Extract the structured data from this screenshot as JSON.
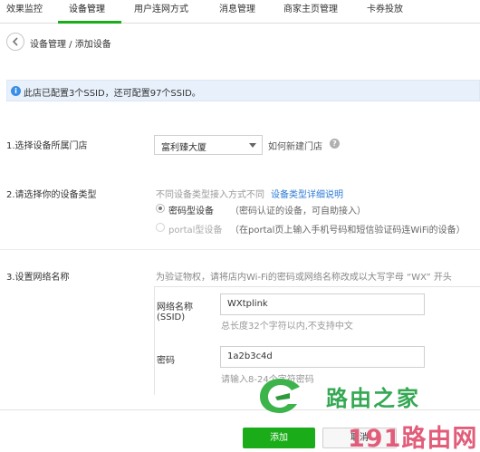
{
  "tabs": [
    {
      "label": "效果监控"
    },
    {
      "label": "设备管理"
    },
    {
      "label": "用户连网方式"
    },
    {
      "label": "消息管理"
    },
    {
      "label": "商家主页管理"
    },
    {
      "label": "卡券投放"
    }
  ],
  "breadcrumb": {
    "text": "设备管理 / 添加设备"
  },
  "notice": {
    "text": "此店已配置3个SSID，还可配置97个SSID。"
  },
  "step1": {
    "label": "1.选择设备所属门店",
    "store_value": "富利臻大厦",
    "help_link": "如何新建门店"
  },
  "step2": {
    "label": "2.请选择你的设备类型",
    "hint": "不同设备类型接入方式不同",
    "detail_link": "设备类型详细说明",
    "options": [
      {
        "label": "密码型设备",
        "desc": "（密码认证的设备，可自助接入）",
        "checked": true
      },
      {
        "label": "portal型设备",
        "desc": "（在portal页上输入手机号码和短信验证码连WiFi的设备）",
        "checked": false
      }
    ]
  },
  "step3": {
    "label": "3.设置网络名称",
    "hint": "为验证物权，请将店内Wi-Fi的密码或网络名称改成以大写字母 “WX” 开头",
    "ssid_label_line1": "网络名称",
    "ssid_label_line2": "(SSID)",
    "ssid_value": "WXtplink",
    "ssid_hint": "总长度32个字符以内,不支持中文",
    "password_label": "密码",
    "password_value": "1a2b3c4d",
    "password_hint": "请输入8-24个字符密码"
  },
  "buttons": {
    "add": "添加",
    "cancel": "取消"
  },
  "watermark": {
    "line1": "路由之家",
    "line2": "191路由网"
  },
  "colors": {
    "accent": "#1aad19",
    "link": "#2b7bd6",
    "info": "#3a8ee6"
  }
}
